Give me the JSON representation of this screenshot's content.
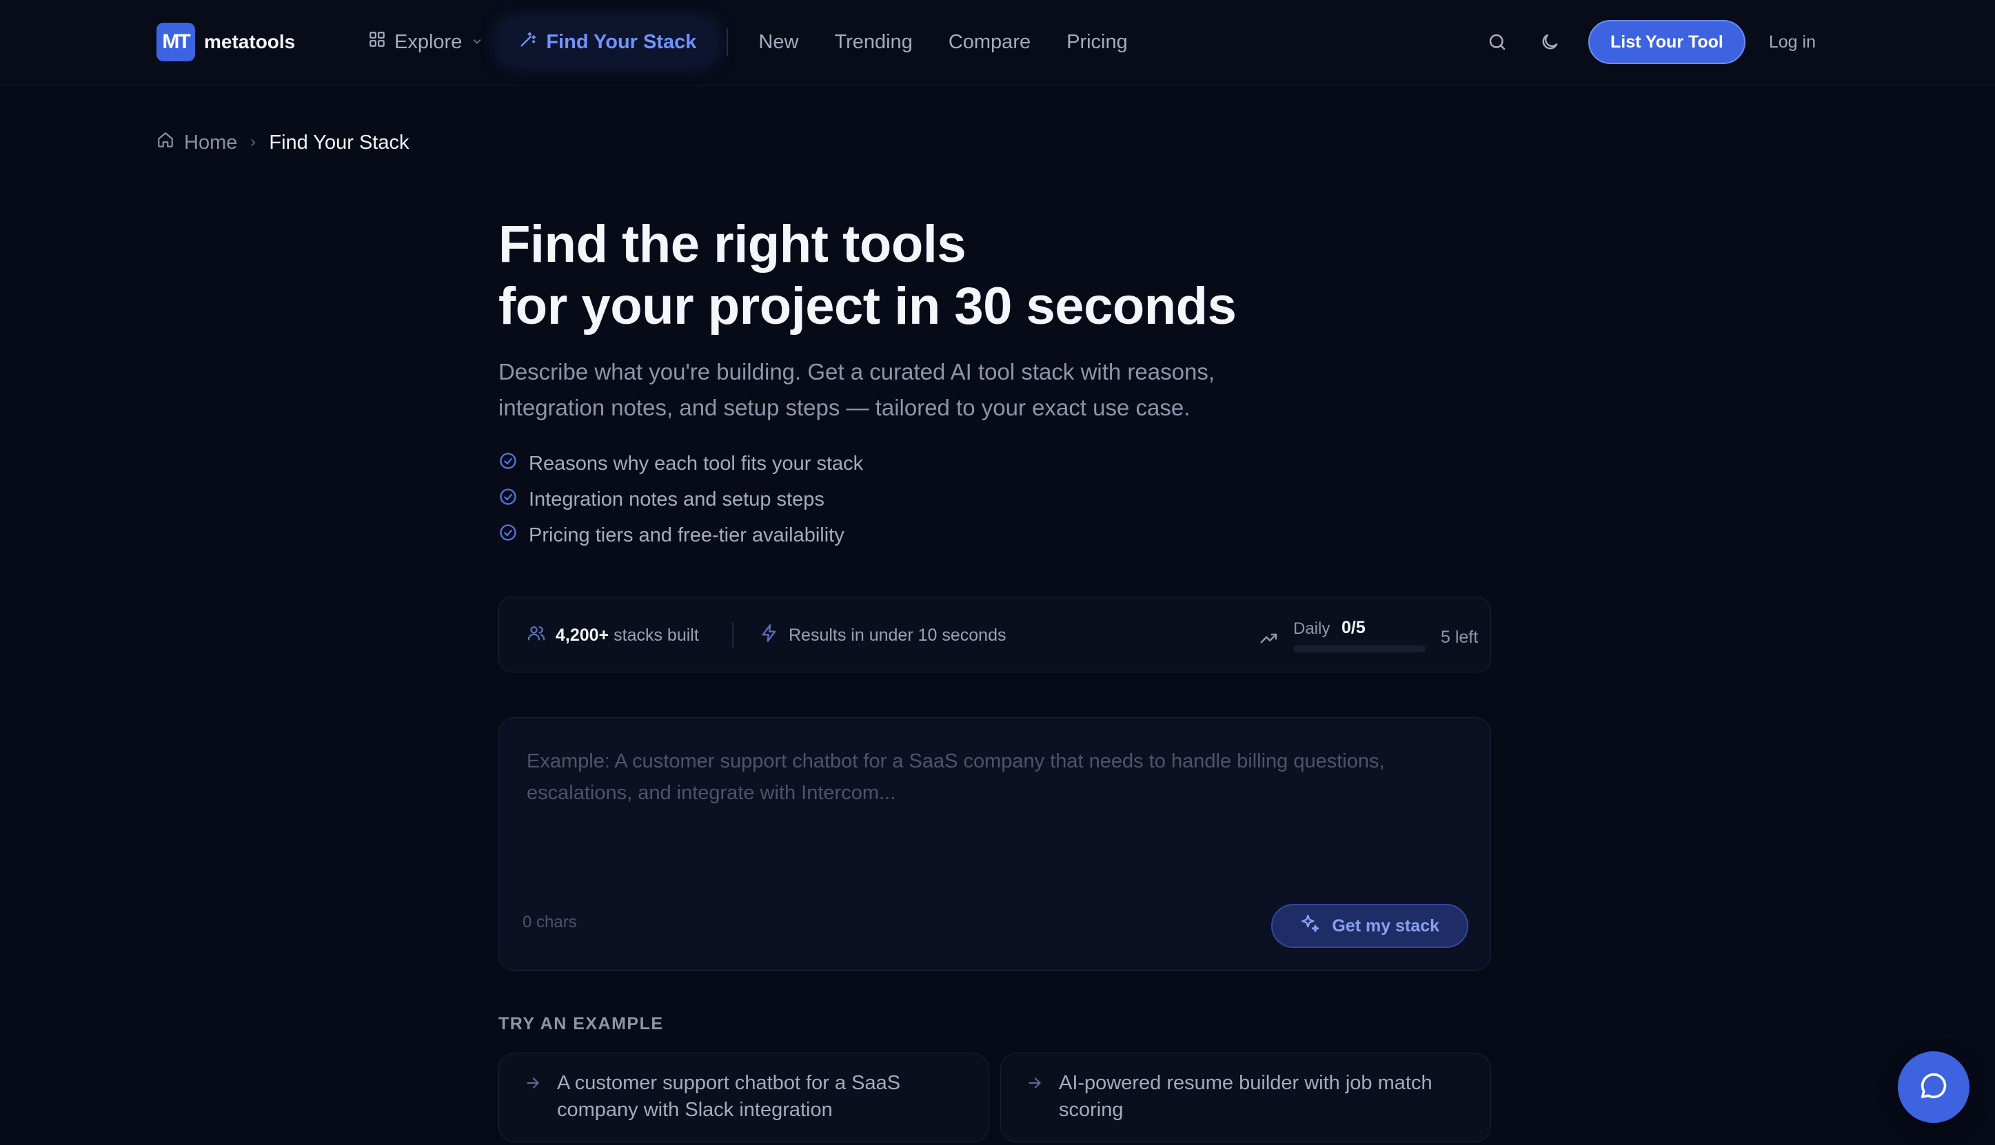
{
  "brand": {
    "logo_mark": "MT",
    "name": "metatools"
  },
  "nav": {
    "items": [
      {
        "label": "Explore",
        "icon": "grid-icon",
        "has_dropdown": true
      },
      {
        "label": "Find Your Stack",
        "icon": "magic-wand-icon",
        "active": true
      },
      {
        "label": "New"
      },
      {
        "label": "Trending"
      },
      {
        "label": "Compare"
      },
      {
        "label": "Pricing"
      }
    ],
    "cta_label": "List Your Tool",
    "login_label": "Log in"
  },
  "breadcrumb": {
    "home": "Home",
    "current": "Find Your Stack"
  },
  "hero": {
    "title_line1": "Find the right tools",
    "title_line2": "for your project in 30 seconds",
    "subtitle": "Describe what you're building. Get a curated AI tool stack with reasons, integration notes, and setup steps — tailored to your exact use case.",
    "checks": [
      "Reasons why each tool fits your stack",
      "Integration notes and setup steps",
      "Pricing tiers and free-tier availability"
    ]
  },
  "stats": {
    "stacks_count": "4,200+",
    "stacks_label": "stacks built",
    "speed_label": "Results in under 10 seconds",
    "daily_label": "Daily",
    "daily_count": "0/5",
    "daily_used_fraction": 0,
    "remaining_label": "5 left"
  },
  "composer": {
    "value": "",
    "placeholder": "Example: A customer support chatbot for a SaaS company that needs to handle billing questions, escalations, and integrate with Intercom...",
    "char_count": "0 chars",
    "submit_label": "Get my stack"
  },
  "examples": {
    "title": "TRY AN EXAMPLE",
    "items": [
      "A customer support chatbot for a SaaS company with Slack integration",
      "AI-powered resume builder with job match scoring"
    ]
  },
  "colors": {
    "background": "#070b18",
    "accent": "#3d63e0",
    "accent_text": "#6f93ff",
    "muted_text": "#8e95a9"
  }
}
